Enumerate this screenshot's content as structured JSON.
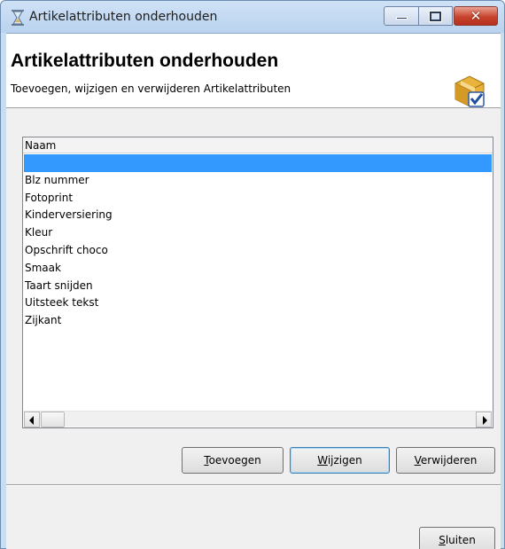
{
  "window": {
    "title": "Artikelattributen onderhouden",
    "icon": "hourglass-icon",
    "controls": [
      "minimize-icon",
      "maximize-icon",
      "close-icon"
    ],
    "close_glyph": "✕"
  },
  "header": {
    "title": "Artikelattributen onderhouden",
    "subtitle": "Toevoegen, wijzigen en verwijderen Artikelattributen",
    "icon": "package-check-icon"
  },
  "list": {
    "column": "Naam",
    "selected_index": 0,
    "items": [
      "",
      "Blz nummer",
      "Fotoprint",
      "Kinderversiering",
      "Kleur",
      "Opschrift choco",
      "Smaak",
      "Taart snijden",
      "Uitsteek tekst",
      "Zijkant"
    ]
  },
  "buttons": {
    "add": {
      "mnemonic": "T",
      "rest": "oevoegen"
    },
    "edit": {
      "mnemonic": "W",
      "rest": "ijzigen"
    },
    "delete": {
      "mnemonic": "V",
      "rest": "erwijderen"
    },
    "close": {
      "mnemonic": "S",
      "rest": "luiten"
    }
  },
  "colors": {
    "selection": "#3399ff",
    "titlebar": "#c9ddf1",
    "close_button": "#c8442e"
  }
}
